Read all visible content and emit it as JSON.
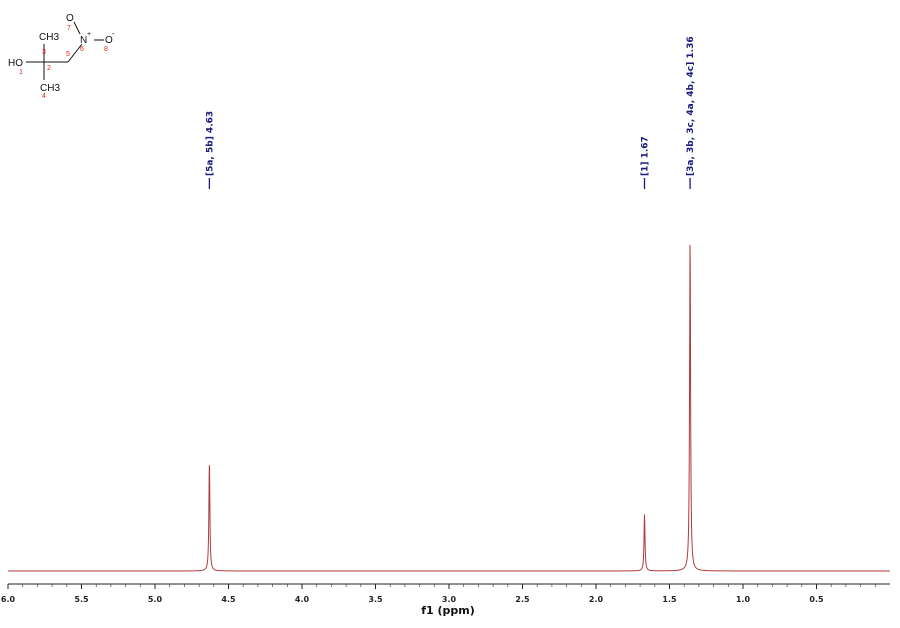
{
  "chart_data": {
    "type": "line",
    "xlabel": "f1 (ppm)",
    "xlim": [
      6.0,
      0.0
    ],
    "x_ticks": [
      "6.0",
      "5.5",
      "5.0",
      "4.5",
      "4.0",
      "3.5",
      "3.0",
      "2.5",
      "2.0",
      "1.5",
      "1.0",
      "0.5"
    ],
    "x_tick_values": [
      6.0,
      5.5,
      5.0,
      4.5,
      4.0,
      3.5,
      3.0,
      2.5,
      2.0,
      1.5,
      1.0,
      0.5
    ],
    "grid": false,
    "line_color": "#b03a3a",
    "label_color": "#1a1a7a",
    "peaks": [
      {
        "ppm": 4.63,
        "relative_height": 0.33,
        "label": "[5a, 5b] 4.63"
      },
      {
        "ppm": 1.67,
        "relative_height": 0.17,
        "label": "[1] 1.67"
      },
      {
        "ppm": 1.36,
        "relative_height": 1.0,
        "label": "[3a, 3b, 3c, 4a, 4b, 4c] 1.36"
      }
    ]
  },
  "molecule": {
    "atoms": {
      "ho": "HO",
      "ch3_top": "CH3",
      "ch3_bottom": "CH3",
      "n": "N",
      "o_top": "O",
      "o_right": "O",
      "n_charge": "+",
      "o_charge": "-"
    },
    "numbers": {
      "n1": "1",
      "n2": "2",
      "n3": "3",
      "n4": "4",
      "n5": "5",
      "n6": "6",
      "n7": "7",
      "n8": "8"
    }
  }
}
